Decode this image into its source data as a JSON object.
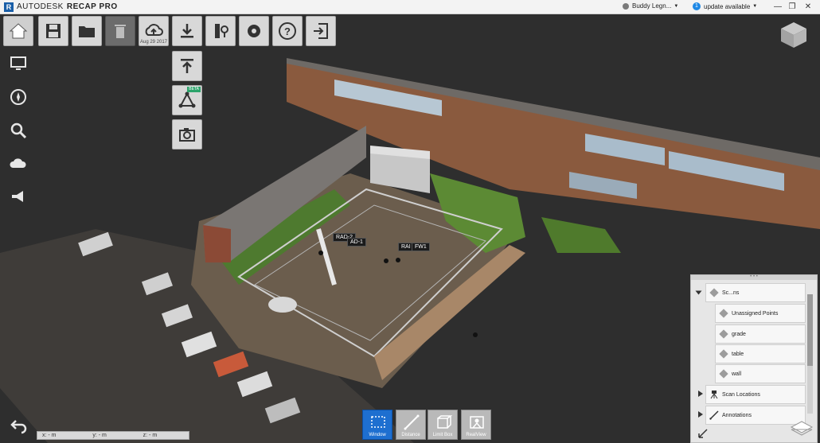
{
  "titlebar": {
    "brand": "AUTODESK",
    "product": "RECAP PRO",
    "user": "Buddy Legn...",
    "update": "update available",
    "update_badge": "1",
    "minimize": "—",
    "restore": "❐",
    "close": "✕"
  },
  "toolbar": {
    "upload_date": "Aug 29 2017",
    "beta_label": "BETA"
  },
  "scene_labels": {
    "rad2": "RAD-2",
    "ad1": "AD-1",
    "rai": "RAI",
    "fw1": "FW1"
  },
  "panel": {
    "scans_label": "Sc...ns",
    "items": [
      "Unassigned Points",
      "grade",
      "table",
      "wall"
    ],
    "scan_locations": "Scan Locations",
    "annotations": "Annotations"
  },
  "bottom_tools": {
    "window": "Window",
    "distance": "Distance",
    "limit_box": "Limit Box",
    "realview": "RealView"
  },
  "coords": {
    "x": "x: - m",
    "y": "y: - m",
    "z": "z: - m"
  }
}
